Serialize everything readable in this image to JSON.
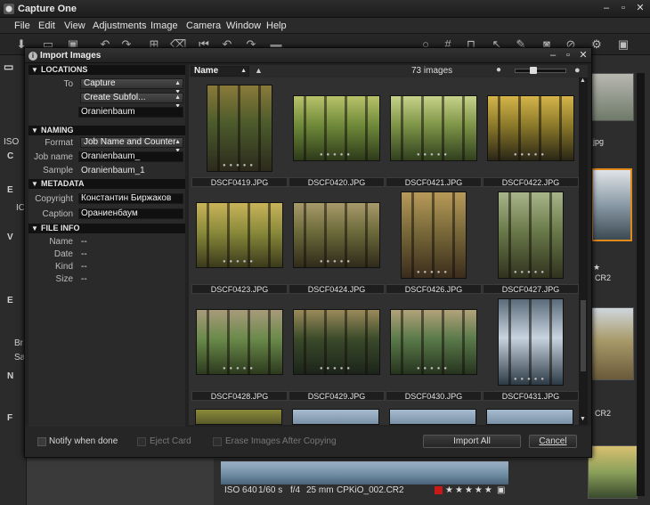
{
  "app": {
    "title": "Capture One",
    "menu": [
      "File",
      "Edit",
      "View",
      "Adjustments",
      "Image",
      "Camera",
      "Window",
      "Help"
    ]
  },
  "background": {
    "left_labels": [
      "ISO",
      "C",
      "E",
      "IO",
      "V",
      "E",
      "Br",
      "Sa",
      "N",
      "F"
    ],
    "right_labels": {
      "jpg": "jpg",
      "cr2a": "CR2",
      "cr2b": "CR2"
    },
    "status": {
      "iso": "ISO 640",
      "shutter": "1/60 s",
      "aperture": "f/4",
      "focal": "25 mm",
      "filename": "CPKiO_002.CR2"
    }
  },
  "dialog": {
    "title": "Import Images",
    "sections": {
      "locations": "LOCATIONS",
      "naming": "NAMING",
      "metadata": "METADATA",
      "fileinfo": "FILE INFO"
    },
    "locations": {
      "to_label": "To",
      "to_value": "Capture",
      "subfolder_value": "Create Subfol...",
      "subfolder_name": "Oranienbaum"
    },
    "naming": {
      "format_label": "Format",
      "format_value": "Job Name and Counter",
      "jobname_label": "Job name",
      "jobname_value": "Oranienbaum_",
      "sample_label": "Sample",
      "sample_value": "Oranienbaum_1"
    },
    "metadata": {
      "copyright_label": "Copyright",
      "copyright_value": "Константин Биржаков",
      "caption_label": "Caption",
      "caption_value": "Ораниенбаум"
    },
    "fileinfo": {
      "name_label": "Name",
      "name_value": "--",
      "date_label": "Date",
      "date_value": "--",
      "kind_label": "Kind",
      "kind_value": "--",
      "size_label": "Size",
      "size_value": "--"
    },
    "grid": {
      "sort_value": "Name",
      "count": "73 images",
      "thumbnails": [
        {
          "file": "DSCF0419.JPG",
          "colors": [
            "#4b5a2b",
            "#8a7a3a",
            "#2c2a1c"
          ],
          "orient": "portrait"
        },
        {
          "file": "DSCF0420.JPG",
          "colors": [
            "#6f8a3a",
            "#b9c26a",
            "#2e3a1a"
          ],
          "orient": "landscape"
        },
        {
          "file": "DSCF0421.JPG",
          "colors": [
            "#7e9447",
            "#c7d38a",
            "#30401e"
          ],
          "orient": "landscape"
        },
        {
          "file": "DSCF0422.JPG",
          "colors": [
            "#8c7a2a",
            "#d5b54a",
            "#2a2616"
          ],
          "orient": "landscape"
        },
        {
          "file": "DSCF0423.JPG",
          "colors": [
            "#8a8a3a",
            "#c9b45a",
            "#3a3a1c"
          ],
          "orient": "landscape"
        },
        {
          "file": "DSCF0424.JPG",
          "colors": [
            "#6c6a3a",
            "#a89a6a",
            "#2f2a1a"
          ],
          "orient": "landscape"
        },
        {
          "file": "DSCF0426.JPG",
          "colors": [
            "#7a6a3a",
            "#b89a5a",
            "#3a2c1c"
          ],
          "orient": "portrait"
        },
        {
          "file": "DSCF0427.JPG",
          "colors": [
            "#6a7a4a",
            "#a9b58a",
            "#30321e"
          ],
          "orient": "portrait"
        },
        {
          "file": "DSCF0428.JPG",
          "colors": [
            "#6a8a4a",
            "#a89a7a",
            "#2c3a1e"
          ],
          "orient": "landscape"
        },
        {
          "file": "DSCF0429.JPG",
          "colors": [
            "#3a4a2a",
            "#9a8a5a",
            "#1c241a"
          ],
          "orient": "landscape"
        },
        {
          "file": "DSCF0430.JPG",
          "colors": [
            "#5a7a4a",
            "#b2a27a",
            "#26341e"
          ],
          "orient": "landscape"
        },
        {
          "file": "DSCF0431.JPG",
          "colors": [
            "#c8d4e0",
            "#5a6a78",
            "#2c3a46"
          ],
          "orient": "portrait"
        }
      ]
    },
    "footer": {
      "notify": "Notify when done",
      "eject": "Eject Card",
      "erase": "Erase Images After Copying",
      "import_btn": "Import All",
      "cancel_btn": "Cancel"
    }
  }
}
